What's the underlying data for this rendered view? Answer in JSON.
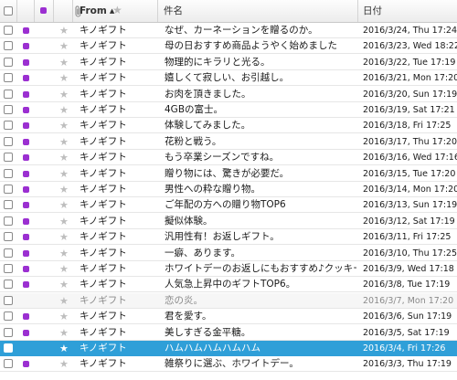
{
  "columns": {
    "from": "From",
    "subject": "件名",
    "date": "日付"
  },
  "colors": {
    "tag": "#9b2fd1",
    "selected": "#2f9fd8"
  },
  "messages": [
    {
      "from": "キノギフト",
      "subject": "なぜ、カーネーションを贈るのか。",
      "date": "2016/3/24, Thu 17:24",
      "tagged": true,
      "read": false,
      "selected": false
    },
    {
      "from": "キノギフト",
      "subject": "母の日おすすめ商品ようやく始めました",
      "date": "2016/3/23, Wed 18:22",
      "tagged": true,
      "read": false,
      "selected": false
    },
    {
      "from": "キノギフト",
      "subject": "物理的にキラリと光る。",
      "date": "2016/3/22, Tue 17:19",
      "tagged": true,
      "read": false,
      "selected": false
    },
    {
      "from": "キノギフト",
      "subject": "嬉しくて寂しい、お引越し。",
      "date": "2016/3/21, Mon 17:20",
      "tagged": true,
      "read": false,
      "selected": false
    },
    {
      "from": "キノギフト",
      "subject": "お肉を頂きました。",
      "date": "2016/3/20, Sun 17:19",
      "tagged": true,
      "read": false,
      "selected": false
    },
    {
      "from": "キノギフト",
      "subject": "4GBの富士。",
      "date": "2016/3/19, Sat 17:21",
      "tagged": true,
      "read": false,
      "selected": false
    },
    {
      "from": "キノギフト",
      "subject": "体験してみました。",
      "date": "2016/3/18, Fri 17:25",
      "tagged": true,
      "read": false,
      "selected": false
    },
    {
      "from": "キノギフト",
      "subject": "花粉と戦う。",
      "date": "2016/3/17, Thu 17:20",
      "tagged": true,
      "read": false,
      "selected": false
    },
    {
      "from": "キノギフト",
      "subject": "もう卒業シーズンですね。",
      "date": "2016/3/16, Wed 17:16",
      "tagged": true,
      "read": false,
      "selected": false
    },
    {
      "from": "キノギフト",
      "subject": "贈り物には、驚きが必要だ。",
      "date": "2016/3/15, Tue 17:20",
      "tagged": true,
      "read": false,
      "selected": false
    },
    {
      "from": "キノギフト",
      "subject": "男性への粋な贈り物。",
      "date": "2016/3/14, Mon 17:20",
      "tagged": true,
      "read": false,
      "selected": false
    },
    {
      "from": "キノギフト",
      "subject": "ご年配の方への贈り物TOP6",
      "date": "2016/3/13, Sun 17:19",
      "tagged": true,
      "read": false,
      "selected": false
    },
    {
      "from": "キノギフト",
      "subject": "擬似体験。",
      "date": "2016/3/12, Sat 17:19",
      "tagged": true,
      "read": false,
      "selected": false
    },
    {
      "from": "キノギフト",
      "subject": "汎用性有！お返しギフト。",
      "date": "2016/3/11, Fri 17:25",
      "tagged": true,
      "read": false,
      "selected": false
    },
    {
      "from": "キノギフト",
      "subject": "一癖、あります。",
      "date": "2016/3/10, Thu 17:25",
      "tagged": true,
      "read": false,
      "selected": false
    },
    {
      "from": "キノギフト",
      "subject": "ホワイトデーのお返しにもおすすめ♪クッキー特集",
      "date": "2016/3/9, Wed 17:18",
      "tagged": true,
      "read": false,
      "selected": false
    },
    {
      "from": "キノギフト",
      "subject": "人気急上昇中のギフトTOP6。",
      "date": "2016/3/8, Tue 17:19",
      "tagged": true,
      "read": false,
      "selected": false
    },
    {
      "from": "キノギフト",
      "subject": "恋の炎。",
      "date": "2016/3/7, Mon 17:20",
      "tagged": false,
      "read": true,
      "selected": false
    },
    {
      "from": "キノギフト",
      "subject": "君を愛す。",
      "date": "2016/3/6, Sun 17:19",
      "tagged": true,
      "read": false,
      "selected": false
    },
    {
      "from": "キノギフト",
      "subject": "美しすぎる金平糖。",
      "date": "2016/3/5, Sat 17:19",
      "tagged": true,
      "read": false,
      "selected": false
    },
    {
      "from": "キノギフト",
      "subject": "ハムハムハムハムハム",
      "date": "2016/3/4, Fri 17:26",
      "tagged": false,
      "read": false,
      "selected": true
    },
    {
      "from": "キノギフト",
      "subject": "雑祭りに選ぶ、ホワイトデー。",
      "date": "2016/3/3, Thu 17:19",
      "tagged": true,
      "read": false,
      "selected": false
    }
  ]
}
